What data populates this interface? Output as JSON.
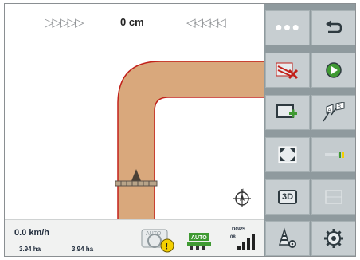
{
  "lightbar": {
    "left_arrows": "▷▷▷▷▷",
    "offset": "0 cm",
    "right_arrows": "◁◁◁◁◁"
  },
  "status": {
    "speed": "0.0 km/h",
    "area_left": "3.94 ha",
    "area_right": "3.94 ha",
    "gps_label": "DGPS",
    "gps_number": "08",
    "auto_label": "AUTO",
    "auto_badge": "AUTO"
  },
  "sidebar": {
    "menu_dots": "●●●",
    "view_3d": "3D"
  },
  "colors": {
    "track": "#d9a87c",
    "track_border": "#c2211a",
    "panel": "#8f9a9e",
    "button": "#c7ced1",
    "green": "#3f9a32",
    "warning": "#f4d000"
  }
}
